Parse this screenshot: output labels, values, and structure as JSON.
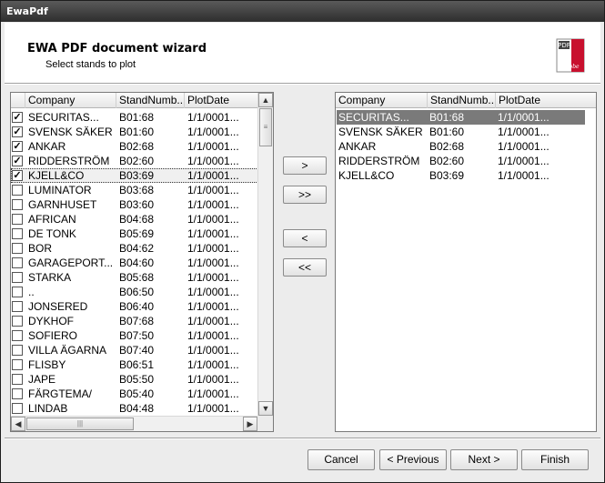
{
  "window": {
    "title": "EwaPdf"
  },
  "header": {
    "title": "EWA PDF document wizard",
    "subtitle": "Select stands to plot",
    "logo_text": "PDF",
    "logo_brand": "Adobe"
  },
  "columns": [
    "Company",
    "StandNumb...",
    "PlotDate"
  ],
  "left_grid": {
    "rows": [
      {
        "checked": true,
        "company": " SECURITAS...",
        "stand": "B01:68",
        "date": "1/1/0001..."
      },
      {
        "checked": true,
        "company": " SVENSK SÄKER",
        "stand": "B01:60",
        "date": "1/1/0001..."
      },
      {
        "checked": true,
        "company": "ANKAR",
        "stand": "B02:68",
        "date": "1/1/0001..."
      },
      {
        "checked": true,
        "company": " RIDDERSTRÖM",
        "stand": "B02:60",
        "date": "1/1/0001..."
      },
      {
        "checked": true,
        "company": " KJELL&CO",
        "stand": "B03:69",
        "date": "1/1/0001..."
      },
      {
        "checked": false,
        "company": "LUMINATOR",
        "stand": "B03:68",
        "date": "1/1/0001..."
      },
      {
        "checked": false,
        "company": "GARNHUSET",
        "stand": "B03:60",
        "date": "1/1/0001..."
      },
      {
        "checked": false,
        "company": "AFRICAN",
        "stand": "B04:68",
        "date": "1/1/0001..."
      },
      {
        "checked": false,
        "company": "DE TONK",
        "stand": "B05:69",
        "date": "1/1/0001..."
      },
      {
        "checked": false,
        "company": "BOR",
        "stand": "B04:62",
        "date": "1/1/0001..."
      },
      {
        "checked": false,
        "company": " GARAGEPORT...",
        "stand": "B04:60",
        "date": "1/1/0001..."
      },
      {
        "checked": false,
        "company": "STARKA",
        "stand": "B05:68",
        "date": "1/1/0001..."
      },
      {
        "checked": false,
        "company": "..",
        "stand": "B06:50",
        "date": "1/1/0001..."
      },
      {
        "checked": false,
        "company": "JONSERED",
        "stand": "B06:40",
        "date": "1/1/0001..."
      },
      {
        "checked": false,
        "company": "DYKHOF",
        "stand": "B07:68",
        "date": "1/1/0001..."
      },
      {
        "checked": false,
        "company": "SOFIERO",
        "stand": "B07:50",
        "date": "1/1/0001..."
      },
      {
        "checked": false,
        "company": "VILLA ÄGARNA",
        "stand": "B07:40",
        "date": "1/1/0001..."
      },
      {
        "checked": false,
        "company": " FLISBY",
        "stand": "B06:51",
        "date": "1/1/0001..."
      },
      {
        "checked": false,
        "company": " JAPE",
        "stand": "B05:50",
        "date": "1/1/0001..."
      },
      {
        "checked": false,
        "company": "FÄRGTEMA/",
        "stand": "B05:40",
        "date": "1/1/0001..."
      },
      {
        "checked": false,
        "company": "LINDAB",
        "stand": "B04:48",
        "date": "1/1/0001..."
      }
    ]
  },
  "right_grid": {
    "rows": [
      {
        "company": " SECURITAS...",
        "stand": "B01:68",
        "date": "1/1/0001..."
      },
      {
        "company": " SVENSK SÄKER",
        "stand": "B01:60",
        "date": "1/1/0001..."
      },
      {
        "company": "ANKAR",
        "stand": "B02:68",
        "date": "1/1/0001..."
      },
      {
        "company": " RIDDERSTRÖM",
        "stand": "B02:60",
        "date": "1/1/0001..."
      },
      {
        "company": " KJELL&CO",
        "stand": "B03:69",
        "date": "1/1/0001..."
      }
    ]
  },
  "transfer": {
    "add_one": ">",
    "add_all": ">>",
    "remove_one": "<",
    "remove_all": "<<"
  },
  "footer": {
    "cancel": "Cancel",
    "previous": "< Previous",
    "next": "Next >",
    "finish": "Finish"
  },
  "colors": {
    "selected_row": "#7a7a7a",
    "titlebar": "#3a3a3a"
  }
}
